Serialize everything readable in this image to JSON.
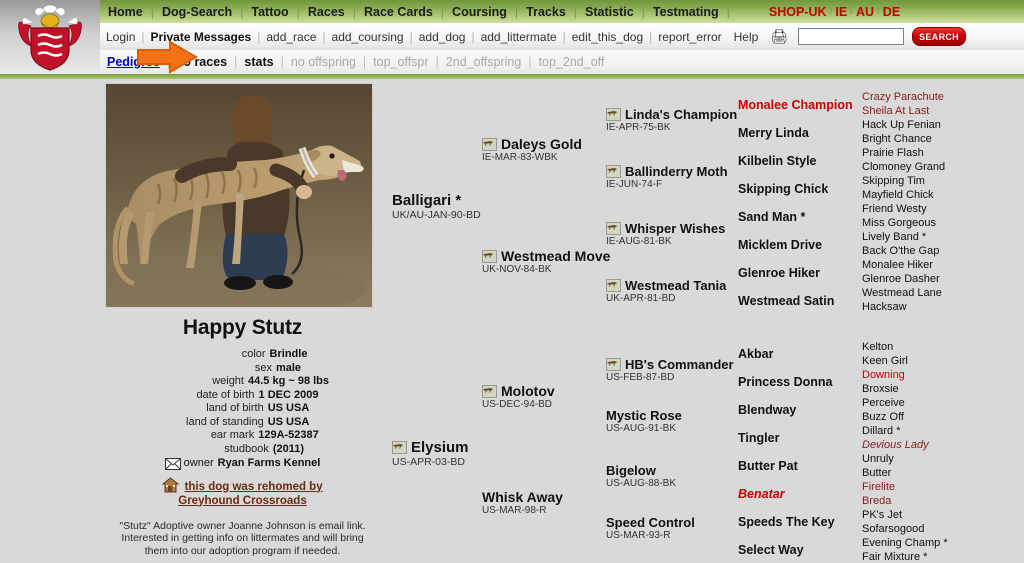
{
  "site": {
    "logo_alt": "coat-of-arms-crest"
  },
  "nav_primary": {
    "items": [
      {
        "label": "Home"
      },
      {
        "label": "Dog-Search"
      },
      {
        "label": "Tattoo"
      },
      {
        "label": "Races"
      },
      {
        "label": "Race Cards"
      },
      {
        "label": "Coursing"
      },
      {
        "label": "Tracks"
      },
      {
        "label": "Statistic"
      },
      {
        "label": "Testmating"
      }
    ],
    "shop": [
      {
        "label": "SHOP-UK"
      },
      {
        "label": "IE"
      },
      {
        "label": "AU"
      },
      {
        "label": "DE"
      }
    ],
    "shop_separator": "/"
  },
  "nav_secondary": {
    "items": [
      {
        "label": "Login",
        "style": "normal"
      },
      {
        "label": "Private Messages",
        "style": "bold"
      },
      {
        "label": "add_race",
        "style": "normal"
      },
      {
        "label": "add_coursing",
        "style": "normal"
      },
      {
        "label": "add_dog",
        "style": "normal"
      },
      {
        "label": "add_littermate",
        "style": "normal"
      },
      {
        "label": "edit_this_dog",
        "style": "normal"
      },
      {
        "label": "report_error",
        "style": "normal"
      },
      {
        "label": "Help",
        "style": "normal"
      }
    ],
    "printer_icon": "printer-icon",
    "search_value": "",
    "search_placeholder": "",
    "search_button": "SEARCH"
  },
  "nav_tertiary": {
    "items": [
      {
        "label": "Pedigree",
        "style": "active"
      },
      {
        "label": "59 races",
        "style": "bold"
      },
      {
        "label": "stats",
        "style": "bold"
      },
      {
        "label": "no offspring",
        "style": "dim"
      },
      {
        "label": "top_offspr",
        "style": "dim"
      },
      {
        "label": "2nd_offspring",
        "style": "dim"
      },
      {
        "label": "top_2nd_off",
        "style": "dim"
      }
    ]
  },
  "cursor": {
    "icon": "orange-arrow-cursor",
    "color": "#f07000"
  },
  "dog": {
    "name": "Happy Stutz",
    "photo_alt": "photo-of-brindle-greyhound-with-woman",
    "facts": [
      {
        "label": "color",
        "value": "Brindle"
      },
      {
        "label": "sex",
        "value": "male"
      },
      {
        "label": "weight",
        "value": "44.5 kg ~ 98 lbs"
      },
      {
        "label": "date of birth",
        "value": "1 DEC 2009"
      },
      {
        "label": "land of birth",
        "value": "US USA"
      },
      {
        "label": "land of standing",
        "value": "US USA"
      },
      {
        "label": "ear mark",
        "value": "129A-52387"
      },
      {
        "label": "studbook",
        "value": "(2011)"
      }
    ],
    "owner_label": "owner",
    "owner_value": "Ryan Farms Kennel",
    "owner_icon": "envelope-icon",
    "rehome_icon": "house-icon",
    "rehome_line1": "this dog was rehomed by",
    "rehome_line2": "Greyhound Crossroads",
    "note": "\"Stutz\" Adoptive owner Joanne Johnson is email link. Interested in getting info on littermates and will bring them into our adoption program if needed."
  },
  "pedigree": {
    "gen1": [
      {
        "name": "Balligari *",
        "date": "UK/AU-JAN-90-BD",
        "icon": false,
        "color": "black"
      },
      {
        "name": "Elysium",
        "date": "US-APR-03-BD",
        "icon": true,
        "color": "black"
      }
    ],
    "gen2": [
      {
        "name": "Daleys Gold",
        "date": "IE-MAR-83-WBK",
        "icon": true,
        "color": "black"
      },
      {
        "name": "Westmead Move",
        "date": "UK-NOV-84-BK",
        "icon": true,
        "color": "black"
      },
      {
        "name": "Molotov",
        "date": "US-DEC-94-BD",
        "icon": true,
        "color": "black"
      },
      {
        "name": "Whisk Away",
        "date": "US-MAR-98-R",
        "icon": false,
        "color": "black"
      }
    ],
    "gen3": [
      {
        "name": "Linda's Champion",
        "date": "IE-APR-75-BK",
        "icon": true,
        "color": "black"
      },
      {
        "name": "Ballinderry Moth",
        "date": "IE-JUN-74-F",
        "icon": true,
        "color": "black"
      },
      {
        "name": "Whisper Wishes",
        "date": "IE-AUG-81-BK",
        "icon": true,
        "color": "black"
      },
      {
        "name": "Westmead Tania",
        "date": "UK-APR-81-BD",
        "icon": true,
        "color": "black"
      },
      {
        "name": "HB's Commander",
        "date": "US-FEB-87-BD",
        "icon": true,
        "color": "black"
      },
      {
        "name": "Mystic Rose",
        "date": "US-AUG-91-BK",
        "icon": false,
        "color": "black"
      },
      {
        "name": "Bigelow",
        "date": "US-AUG-88-BK",
        "icon": false,
        "color": "black"
      },
      {
        "name": "Speed Control",
        "date": "US-MAR-93-R",
        "icon": false,
        "color": "black"
      }
    ],
    "gen4": [
      {
        "name": "Monalee Champion",
        "color": "red"
      },
      {
        "name": "Merry Linda",
        "color": "black"
      },
      {
        "name": "Kilbelin Style",
        "color": "black"
      },
      {
        "name": "Skipping Chick",
        "color": "black"
      },
      {
        "name": "Sand Man *",
        "color": "black"
      },
      {
        "name": "Micklem Drive",
        "color": "black"
      },
      {
        "name": "Glenroe Hiker",
        "color": "black"
      },
      {
        "name": "Westmead Satin",
        "color": "black"
      },
      {
        "name": "Akbar",
        "color": "black"
      },
      {
        "name": "Princess Donna",
        "color": "black"
      },
      {
        "name": "Blendway",
        "color": "black"
      },
      {
        "name": "Tingler",
        "color": "black"
      },
      {
        "name": "Butter Pat",
        "color": "black"
      },
      {
        "name": "Benatar",
        "color": "red-italic"
      },
      {
        "name": "Speeds The Key",
        "color": "black"
      },
      {
        "name": "Select Way",
        "color": "black"
      }
    ],
    "gen5": [
      {
        "name": "Crazy Parachute",
        "color": "dark-red"
      },
      {
        "name": "Sheila At Last",
        "color": "dark-red"
      },
      {
        "name": "Hack Up Fenian",
        "color": "black"
      },
      {
        "name": "Bright Chance",
        "color": "black"
      },
      {
        "name": "Prairie Flash",
        "color": "black"
      },
      {
        "name": "Clomoney Grand",
        "color": "black"
      },
      {
        "name": "Skipping Tim",
        "color": "black"
      },
      {
        "name": "Mayfield Chick",
        "color": "black"
      },
      {
        "name": "Friend Westy",
        "color": "black"
      },
      {
        "name": "Miss Gorgeous",
        "color": "black"
      },
      {
        "name": "Lively Band *",
        "color": "black"
      },
      {
        "name": "Back O'the Gap",
        "color": "black"
      },
      {
        "name": "Monalee Hiker",
        "color": "black"
      },
      {
        "name": "Glenroe Dasher",
        "color": "black"
      },
      {
        "name": "Westmead Lane",
        "color": "black"
      },
      {
        "name": "Hacksaw",
        "color": "black"
      },
      {
        "name": "Kelton",
        "color": "black"
      },
      {
        "name": "Keen Girl",
        "color": "black"
      },
      {
        "name": "Downing",
        "color": "red"
      },
      {
        "name": "Broxsie",
        "color": "black"
      },
      {
        "name": "Perceive",
        "color": "black"
      },
      {
        "name": "Buzz Off",
        "color": "black"
      },
      {
        "name": "Dillard *",
        "color": "black"
      },
      {
        "name": "Devious Lady",
        "color": "dark-red-italic"
      },
      {
        "name": "Unruly",
        "color": "black"
      },
      {
        "name": "Butter",
        "color": "black"
      },
      {
        "name": "Firelite",
        "color": "dark-red"
      },
      {
        "name": "Breda",
        "color": "dark-red"
      },
      {
        "name": "PK's Jet",
        "color": "black"
      },
      {
        "name": "Sofarsogood",
        "color": "black"
      },
      {
        "name": "Evening Champ *",
        "color": "black"
      },
      {
        "name": "Fair Mixture *",
        "color": "black"
      }
    ]
  },
  "colors": {
    "nav_green": "#8cae53",
    "shop_red": "#c00000",
    "link_blue": "#0000cc",
    "page_bg": "#d9d9d9",
    "cursor_orange": "#f07000"
  }
}
